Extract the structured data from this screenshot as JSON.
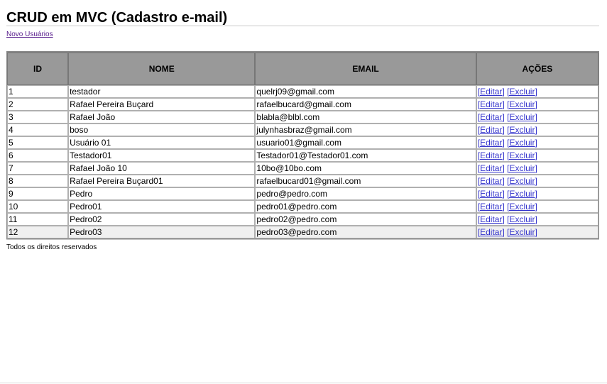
{
  "page": {
    "title": "CRUD em MVC (Cadastro e-mail)",
    "new_user_link": "Novo Usuários",
    "footer": "Todos os direitos reservados"
  },
  "table": {
    "headers": [
      "ID",
      "NOME",
      "EMAIL",
      "AÇÕES"
    ],
    "edit_label": "[Editar]",
    "delete_label": "[Excluir]",
    "rows": [
      {
        "id": "1",
        "nome": "testador",
        "email": "quelrj09@gmail.com"
      },
      {
        "id": "2",
        "nome": "Rafael Pereira Buçard",
        "email": "rafaelbucard@gmail.com"
      },
      {
        "id": "3",
        "nome": "Rafael João",
        "email": "blabla@blbl.com"
      },
      {
        "id": "4",
        "nome": "boso",
        "email": "julynhasbraz@gmail.com"
      },
      {
        "id": "5",
        "nome": "Usuário 01",
        "email": "usuario01@gmail.com"
      },
      {
        "id": "6",
        "nome": "Testador01",
        "email": "Testador01@Testador01.com"
      },
      {
        "id": "7",
        "nome": "Rafael João 10",
        "email": "10bo@10bo.com"
      },
      {
        "id": "8",
        "nome": "Rafael Pereira Buçard01",
        "email": "rafaelbucard01@gmail.com"
      },
      {
        "id": "9",
        "nome": "Pedro",
        "email": "pedro@pedro.com"
      },
      {
        "id": "10",
        "nome": "Pedro01",
        "email": "pedro01@pedro.com"
      },
      {
        "id": "11",
        "nome": "Pedro02",
        "email": "pedro02@pedro.com"
      },
      {
        "id": "12",
        "nome": "Pedro03",
        "email": "pedro03@pedro.com"
      }
    ]
  },
  "colors": {
    "header_bg": "#999999",
    "link_visited": "#551a8b",
    "action_link": "#3333cc"
  }
}
